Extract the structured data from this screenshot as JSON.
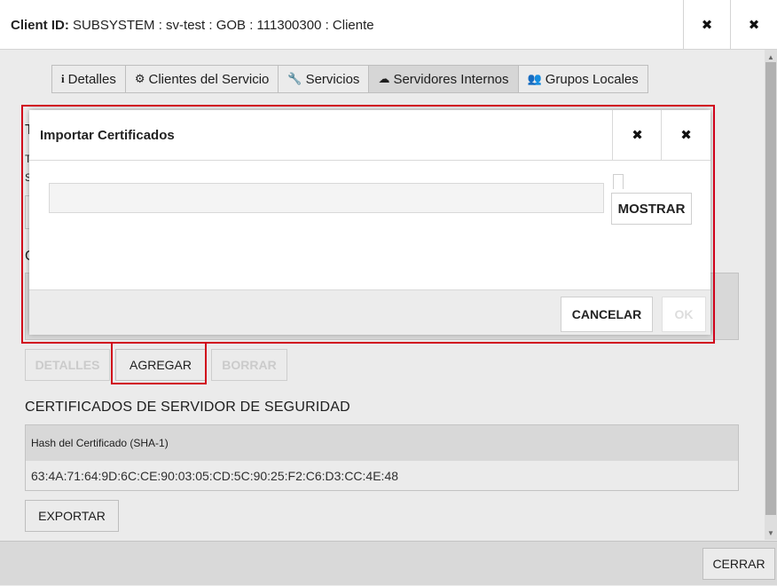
{
  "outer": {
    "title_label": "Client ID:",
    "title_value": "SUBSYSTEM : sv-test : GOB : 111300300 : Cliente",
    "fullscreen_icon": "✖",
    "close_icon": "✖"
  },
  "tabs": [
    {
      "icon": "i",
      "label": "Detalles"
    },
    {
      "icon": "⚙",
      "label": "Clientes del Servicio"
    },
    {
      "icon": "🔧",
      "label": "Servicios"
    },
    {
      "icon": "☁",
      "label": "Servidores Internos"
    },
    {
      "icon": "👥",
      "label": "Grupos Locales"
    }
  ],
  "background": {
    "section_T": "T",
    "section_line1": "T",
    "section_line2": "S",
    "section_C": "C",
    "buttons": {
      "details": "DETALLES",
      "add": "AGREGAR",
      "delete": "BORRAR"
    },
    "cert_section_title": "CERTIFICADOS DE SERVIDOR DE SEGURIDAD",
    "cert_table_header": "Hash del Certificado (SHA-1)",
    "cert_hash": "63:4A:71:64:9D:6C:CE:90:03:05:CD:5C:90:25:F2:C6:D3:CC:4E:48",
    "export_button": "EXPORTAR",
    "close_button": "CERRAR"
  },
  "modal": {
    "title": "Importar Certificados",
    "file_input_value": "",
    "show_button": "MOSTRAR",
    "cancel_button": "CANCELAR",
    "ok_button": "OK"
  },
  "colors": {
    "highlight": "#d0021b",
    "active_tab": "#e9e9e9"
  }
}
